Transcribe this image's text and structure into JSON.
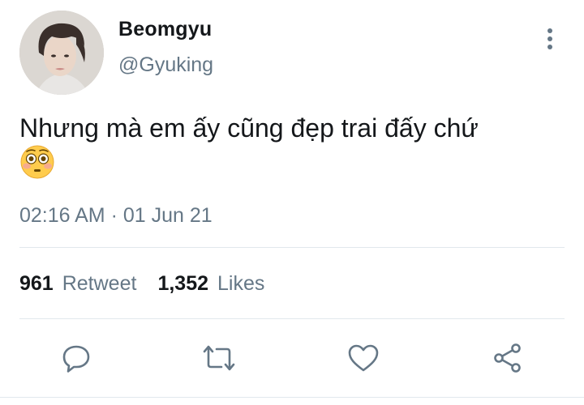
{
  "user": {
    "display_name": "Beomgyu",
    "handle": "@Gyuking",
    "avatar_icon": "profile-photo"
  },
  "tweet": {
    "text": "Nhưng mà em ấy cũng đẹp trai đấy chứ",
    "emoji": "flushed-face-emoji",
    "timestamp": "02:16 AM · 01 Jun 21"
  },
  "stats": {
    "retweet_count": "961",
    "retweet_label": "Retweet",
    "like_count": "1,352",
    "like_label": "Likes"
  },
  "actions": [
    {
      "name": "reply",
      "icon": "reply-icon"
    },
    {
      "name": "retweet",
      "icon": "retweet-icon"
    },
    {
      "name": "like",
      "icon": "heart-icon"
    },
    {
      "name": "share",
      "icon": "share-icon"
    }
  ],
  "colors": {
    "primary_text": "#14171a",
    "secondary_text": "#657786",
    "divider": "#e1e8ed",
    "icon": "#657786"
  }
}
